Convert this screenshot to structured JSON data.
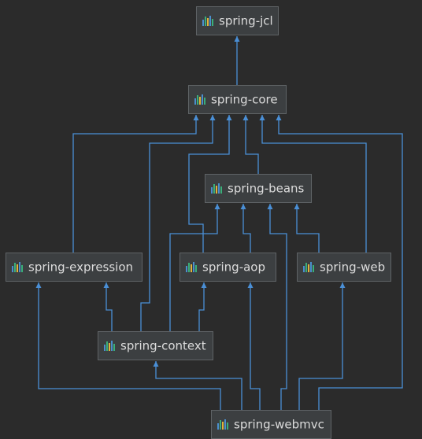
{
  "colors": {
    "background": "#2b2b2b",
    "node_fill": "#3c3f41",
    "node_border": "#5f6366",
    "edge": "#4a8fd6",
    "label": "#dcdcdc",
    "icon_bars": [
      "#4b8fcd",
      "#3aaf7a",
      "#e1b43c",
      "#4b8fcd",
      "#3aaf7a"
    ]
  },
  "nodes": [
    {
      "id": "spring-jcl",
      "label": "spring-jcl",
      "icon": "module-bars-icon"
    },
    {
      "id": "spring-core",
      "label": "spring-core",
      "icon": "module-bars-icon"
    },
    {
      "id": "spring-beans",
      "label": "spring-beans",
      "icon": "module-bars-icon"
    },
    {
      "id": "spring-expression",
      "label": "spring-expression",
      "icon": "module-bars-icon"
    },
    {
      "id": "spring-aop",
      "label": "spring-aop",
      "icon": "module-bars-icon"
    },
    {
      "id": "spring-web",
      "label": "spring-web",
      "icon": "module-bars-icon"
    },
    {
      "id": "spring-context",
      "label": "spring-context",
      "icon": "module-bars-icon"
    },
    {
      "id": "spring-webmvc",
      "label": "spring-webmvc",
      "icon": "module-bars-icon"
    }
  ],
  "edges": [
    {
      "from": "spring-core",
      "to": "spring-jcl"
    },
    {
      "from": "spring-expression",
      "to": "spring-core"
    },
    {
      "from": "spring-context",
      "to": "spring-core"
    },
    {
      "from": "spring-aop",
      "to": "spring-core"
    },
    {
      "from": "spring-beans",
      "to": "spring-core"
    },
    {
      "from": "spring-web",
      "to": "spring-core"
    },
    {
      "from": "spring-webmvc",
      "to": "spring-core"
    },
    {
      "from": "spring-context",
      "to": "spring-beans"
    },
    {
      "from": "spring-aop",
      "to": "spring-beans"
    },
    {
      "from": "spring-webmvc",
      "to": "spring-beans"
    },
    {
      "from": "spring-web",
      "to": "spring-beans"
    },
    {
      "from": "spring-webmvc",
      "to": "spring-expression"
    },
    {
      "from": "spring-context",
      "to": "spring-expression"
    },
    {
      "from": "spring-context",
      "to": "spring-aop"
    },
    {
      "from": "spring-webmvc",
      "to": "spring-aop"
    },
    {
      "from": "spring-webmvc",
      "to": "spring-web"
    },
    {
      "from": "spring-webmvc",
      "to": "spring-context"
    }
  ]
}
